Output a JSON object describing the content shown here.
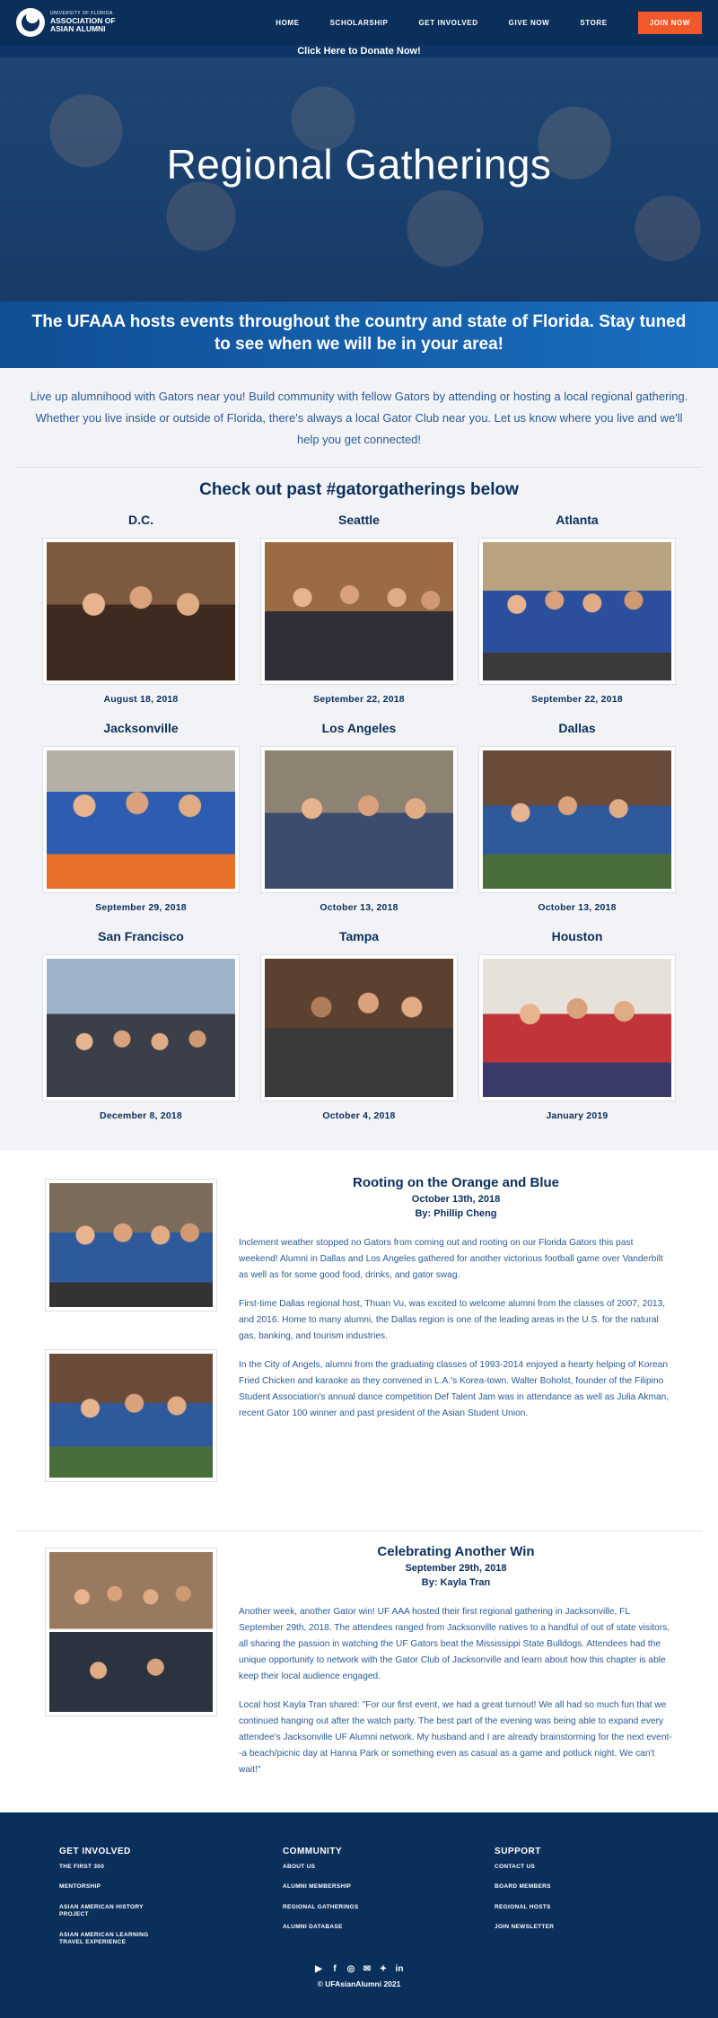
{
  "header": {
    "logo_small": "UNIVERSITY OF FLORIDA",
    "logo_big_1": "ASSOCIATION OF",
    "logo_big_2": "ASIAN ALUMNI",
    "nav": [
      "HOME",
      "SCHOLARSHIP",
      "GET INVOLVED",
      "GIVE NOW",
      "STORE"
    ],
    "join_label": "JOIN NOW"
  },
  "donate_bar": "Click Here to Donate Now!",
  "hero": {
    "title": "Regional Gatherings"
  },
  "tagline": "The UFAAA hosts events throughout the country and state of Florida. Stay tuned to see when we will be in your area!",
  "intro": "Live up alumnihood with Gators near you! Build community with fellow Gators by attending or hosting a local regional gathering. Whether you live inside or outside of Florida, there's always a local Gator Club near you. Let us know where you live and we'll help you get connected!",
  "gallery": {
    "heading": "Check out past #gatorgatherings below",
    "cards": [
      {
        "city": "D.C.",
        "date": "August 18, 2018"
      },
      {
        "city": "Seattle",
        "date": "September 22, 2018"
      },
      {
        "city": "Atlanta",
        "date": "September 22, 2018"
      },
      {
        "city": "Jacksonville",
        "date": "September 29, 2018"
      },
      {
        "city": "Los Angeles",
        "date": "October 13, 2018"
      },
      {
        "city": "Dallas",
        "date": "October 13, 2018"
      },
      {
        "city": "San Francisco",
        "date": "December 8, 2018"
      },
      {
        "city": "Tampa",
        "date": "October 4, 2018"
      },
      {
        "city": "Houston",
        "date": "January 2019"
      }
    ]
  },
  "articles": [
    {
      "title": "Rooting on the Orange and Blue",
      "date": "October 13th, 2018",
      "author": "By: Phillip Cheng",
      "paragraphs": [
        "Inclement weather stopped no Gators from coming out and rooting on our Florida Gators this past weekend! Alumni in Dallas and Los Angeles gathered for another victorious football game over Vanderbilt as well as for some good food, drinks, and gator swag.",
        "First-time Dallas regional host, Thuan Vu, was excited to welcome alumni from the classes of 2007, 2013, and 2016. Home to many alumni, the Dallas region is one of the leading areas in the U.S. for the natural gas, banking, and tourism industries.",
        "In the City of Angels, alumni from the graduating classes of 1993-2014 enjoyed a hearty helping of Korean Fried Chicken and karaoke as they convened in L.A.'s Korea-town. Walter Boholst, founder of the Filipino Student Association's annual dance competition Def Talent Jam was in attendance as well as Julia Akman, recent Gator 100 winner and past president of the Asian Student Union."
      ]
    },
    {
      "title": "Celebrating Another Win",
      "date": "September 29th, 2018",
      "author": "By: Kayla Tran",
      "paragraphs": [
        "Another week, another Gator win! UF AAA hosted their first regional gathering in Jacksonville, FL September 29th, 2018. The attendees ranged from Jacksonville natives to a handful of out of state visitors, all sharing the passion in watching the UF Gators beat the Mississippi State Bulldogs. Attendees had the unique opportunity to network with the Gator Club of Jacksonville and learn about how this chapter is able keep their local audience engaged.",
        "Local host Kayla Tran shared: \"For our first event, we had a great turnout! We all had so much fun that we continued hanging out after the watch party. The best part of the evening was being able to expand every attendee's Jacksonville UF Alumni network. My husband and I are already brainstorming for the next event--a beach/picnic day at Hanna Park or something even as casual as a game and potluck night. We can't wait!\""
      ]
    }
  ],
  "footer": {
    "columns": [
      {
        "title": "GET INVOLVED",
        "links": [
          "THE FIRST 300",
          "MENTORSHIP",
          "ASIAN AMERICAN HISTORY PROJECT",
          "ASIAN AMERICAN LEARNING TRAVEL EXPERIENCE"
        ]
      },
      {
        "title": "COMMUNITY",
        "links": [
          "ABOUT US",
          "ALUMNI MEMBERSHIP",
          "REGIONAL GATHERINGS",
          "ALUMNI DATABASE"
        ]
      },
      {
        "title": "SUPPORT",
        "links": [
          "CONTACT US",
          "BOARD MEMBERS",
          "REGIONAL HOSTS",
          "JOIN NEWSLETTER"
        ]
      }
    ],
    "social_icons": [
      "youtube-icon",
      "facebook-icon",
      "instagram-icon",
      "email-icon",
      "twitter-icon",
      "linkedin-icon"
    ],
    "copyright": "© UFAsianAlumni 2021"
  },
  "colors": {
    "navy": "#0b2f5b",
    "accent_orange": "#f2592a",
    "tagline_blue": "#1565b2",
    "text_blue": "#2a5b95"
  }
}
